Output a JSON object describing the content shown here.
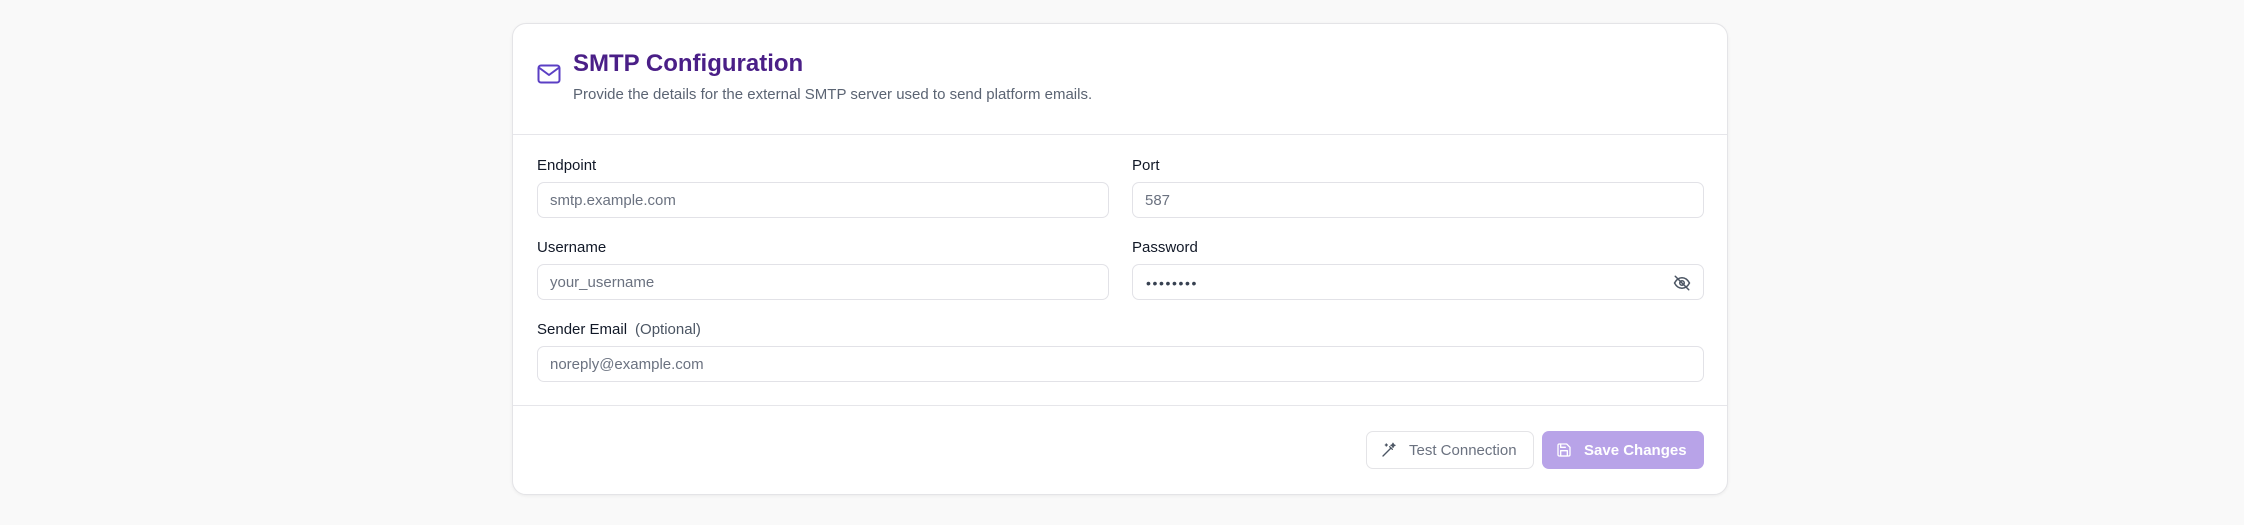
{
  "header": {
    "title": "SMTP Configuration",
    "subtitle": "Provide the details for the external SMTP server used to send platform emails.",
    "icon": "mail-icon"
  },
  "fields": {
    "endpoint": {
      "label": "Endpoint",
      "placeholder": "smtp.example.com"
    },
    "port": {
      "label": "Port",
      "placeholder": "587"
    },
    "username": {
      "label": "Username",
      "placeholder": "your_username"
    },
    "password": {
      "label": "Password",
      "masked_value": "••••••••",
      "icon": "eye-off-icon"
    },
    "sender_email": {
      "label": "Sender Email",
      "optional": "(Optional)",
      "placeholder": "noreply@example.com"
    }
  },
  "actions": {
    "test_label": "Test Connection",
    "test_icon": "wand-icon",
    "save_label": "Save Changes",
    "save_icon": "save-icon"
  },
  "colors": {
    "accent": "#4a1f87",
    "save_button": "#b8a3e8",
    "icon": "#5b3fc4"
  }
}
